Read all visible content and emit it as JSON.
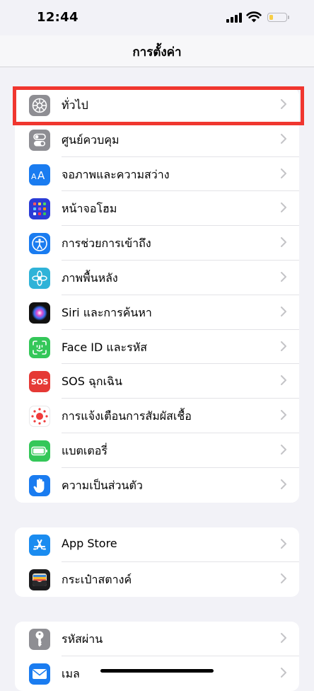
{
  "status": {
    "time": "12:44"
  },
  "nav": {
    "title": "การตั้งค่า"
  },
  "groups": [
    {
      "items": [
        {
          "label": "ทั่วไป",
          "icon": "gear-icon",
          "color": "#8e8e93"
        },
        {
          "label": "ศูนย์ควบคุม",
          "icon": "toggles-icon",
          "color": "#8e8e93"
        },
        {
          "label": "จอภาพและความสว่าง",
          "icon": "text-size-icon",
          "color": "#1a7cf0"
        },
        {
          "label": "หน้าจอโฮม",
          "icon": "app-grid-icon",
          "color": "#2b3cd6"
        },
        {
          "label": "การช่วยการเข้าถึง",
          "icon": "accessibility-icon",
          "color": "#1a7cf0"
        },
        {
          "label": "ภาพพื้นหลัง",
          "icon": "flower-icon",
          "color": "#2fb3d8"
        },
        {
          "label": "Siri และการค้นหา",
          "icon": "siri-icon",
          "color": "#111111"
        },
        {
          "label": "Face ID และรหัส",
          "icon": "face-id-icon",
          "color": "#34c759"
        },
        {
          "label": "SOS ฉุกเฉิน",
          "icon": "sos-icon",
          "color": "#e53935",
          "icon_text": "SOS"
        },
        {
          "label": "การแจ้งเตือนการสัมผัสเชื้อ",
          "icon": "exposure-icon",
          "color": "#ffffff"
        },
        {
          "label": "แบตเตอรี่",
          "icon": "battery-icon",
          "color": "#34c759"
        },
        {
          "label": "ความเป็นส่วนตัว",
          "icon": "hand-icon",
          "color": "#1a7cf0"
        }
      ]
    },
    {
      "items": [
        {
          "label": "App Store",
          "icon": "app-store-icon",
          "color": "#1a8cf0"
        },
        {
          "label": "กระเป๋าสตางค์",
          "icon": "wallet-icon",
          "color": "#1c1c1e"
        }
      ]
    },
    {
      "items": [
        {
          "label": "รหัสผ่าน",
          "icon": "key-icon",
          "color": "#8e8e93"
        },
        {
          "label": "เมล",
          "icon": "mail-icon",
          "color": "#1a7cf0"
        }
      ]
    }
  ],
  "highlight": {
    "target": "ทั่วไป",
    "color": "#f0362f"
  }
}
